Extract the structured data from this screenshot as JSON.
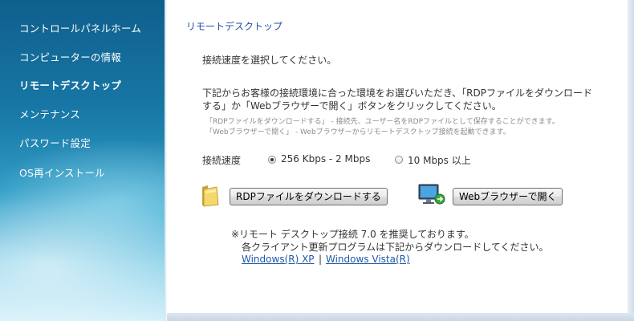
{
  "sidebar": {
    "items": [
      {
        "label": "コントロールパネルホーム",
        "active": false
      },
      {
        "label": "コンピューターの情報",
        "active": false
      },
      {
        "label": "リモートデスクトップ",
        "active": true
      },
      {
        "label": "メンテナンス",
        "active": false
      },
      {
        "label": "パスワード設定",
        "active": false
      },
      {
        "label": "OS再インストール",
        "active": false
      }
    ]
  },
  "main": {
    "section_title": "リモートデスクトップ",
    "instruction": "接続速度を選択してください。",
    "description_line1": "下記からお客様の接続環境に合った環境をお選びいただき、「RDPファイルをダウンロード",
    "description_line2": "する」か「Webブラウザーで開く」ボタンをクリックしてください。",
    "note_line1": "「RDPファイルをダウンロードする」 - 接続先、ユーザー名をRDPファイルとして保存することができます。",
    "note_line2": "「Webブラウザーで開く」 - Webブラウザーからリモートデスクトップ接続を起動できます。",
    "speed_label": "接続速度",
    "speed_options": [
      {
        "label": "256 Kbps - 2 Mbps",
        "checked": true
      },
      {
        "label": "10 Mbps 以上",
        "checked": false
      }
    ],
    "download_button": "RDPファイルをダウンロードする",
    "browser_button": "Webブラウザーで開く",
    "footnote_line1": "※リモート デスクトップ接続 7.0 を推奨しております。",
    "footnote_line2": "各クライアント更新プログラムは下記からダウンロードしてください。",
    "link_xp": "Windows(R) XP",
    "link_separator": "|",
    "link_vista": "Windows Vista(R)"
  },
  "colors": {
    "title_blue": "#1e4f9c",
    "link_blue": "#1f5aa8",
    "sidebar_dark": "#0f5f8c"
  },
  "icons": {
    "download": "folder-icon",
    "browser": "remote-monitor-icon"
  }
}
